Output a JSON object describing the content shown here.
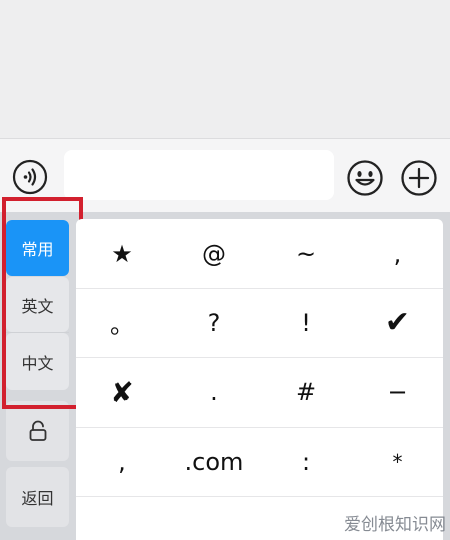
{
  "input": {
    "value": "",
    "placeholder": ""
  },
  "icons": {
    "voice": "voice-wave-icon",
    "emoji": "smiley-face-icon",
    "plus": "add-circle-icon",
    "lock": "lock-icon"
  },
  "categories": [
    {
      "label": "常用",
      "active": true
    },
    {
      "label": "英文",
      "active": false
    },
    {
      "label": "中文",
      "active": false
    }
  ],
  "back_label": "返回",
  "symbols": [
    [
      "★",
      "@",
      "~",
      ","
    ],
    [
      "。",
      "?",
      "!",
      "✔"
    ],
    [
      "✘",
      ".",
      "#",
      "−"
    ],
    [
      ",",
      ".com",
      ":",
      "*"
    ]
  ],
  "watermark": "爱创根知识网",
  "colors": {
    "active": "#1a94f7",
    "highlight": "#d2202e",
    "keyboard_bg": "#d6d8dc"
  }
}
